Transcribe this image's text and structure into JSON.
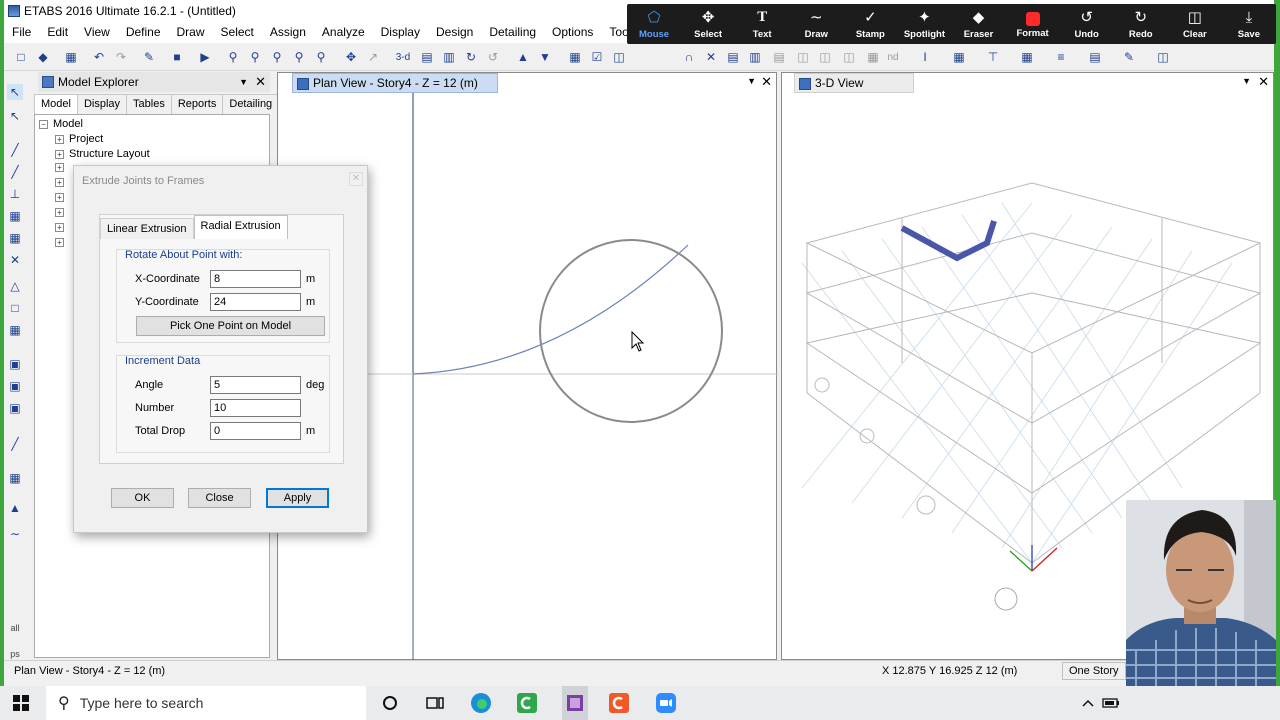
{
  "app": {
    "title": "ETABS 2016 Ultimate 16.2.1 - (Untitled)"
  },
  "menu": [
    "File",
    "Edit",
    "View",
    "Define",
    "Draw",
    "Select",
    "Assign",
    "Analyze",
    "Display",
    "Design",
    "Detailing",
    "Options",
    "Tools"
  ],
  "annotation_toolbar": [
    {
      "label": "Mouse",
      "icon": "cursor-icon",
      "active": true
    },
    {
      "label": "Select",
      "icon": "move-icon"
    },
    {
      "label": "Text",
      "icon": "text-icon"
    },
    {
      "label": "Draw",
      "icon": "draw-icon"
    },
    {
      "label": "Stamp",
      "icon": "stamp-icon"
    },
    {
      "label": "Spotlight",
      "icon": "spotlight-icon"
    },
    {
      "label": "Eraser",
      "icon": "eraser-icon"
    },
    {
      "label": "Format",
      "icon": "format-icon",
      "color": "#ff2a2a"
    },
    {
      "label": "Undo",
      "icon": "undo-icon"
    },
    {
      "label": "Redo",
      "icon": "redo-icon"
    },
    {
      "label": "Clear",
      "icon": "trash-icon"
    },
    {
      "label": "Save",
      "icon": "save-icon"
    }
  ],
  "explorer": {
    "title": "Model Explorer",
    "tabs": [
      "Model",
      "Display",
      "Tables",
      "Reports",
      "Detailing"
    ],
    "tree_root": "Model",
    "tree_items": [
      "Project",
      "Structure Layout"
    ]
  },
  "views": {
    "plan": {
      "title": "Plan View - Story4 - Z = 12 (m)"
    },
    "three_d": {
      "title": "3-D View"
    }
  },
  "dialog": {
    "title": "Extrude Joints to Frames",
    "tabs": [
      "Linear Extrusion",
      "Radial Extrusion"
    ],
    "active_tab": "Radial Extrusion",
    "rotate_group": "Rotate About Point with:",
    "x_label": "X-Coordinate",
    "x_value": "8",
    "x_unit": "m",
    "y_label": "Y-Coordinate",
    "y_value": "24",
    "y_unit": "m",
    "pick_button": "Pick One Point on Model",
    "increment_group": "Increment Data",
    "angle_label": "Angle",
    "angle_value": "5",
    "angle_unit": "deg",
    "number_label": "Number",
    "number_value": "10",
    "drop_label": "Total Drop",
    "drop_value": "0",
    "drop_unit": "m",
    "ok": "OK",
    "close": "Close",
    "apply": "Apply"
  },
  "status": {
    "left": "Plan View - Story4 - Z = 12 (m)",
    "coords": "X 12.875  Y 16.925  Z 12 (m)",
    "story": "One Story"
  },
  "sidebar_cutoff": [
    "all",
    "ps"
  ],
  "taskbar": {
    "search_placeholder": "Type here to search",
    "apps": [
      "cortana-icon",
      "task-view-icon",
      "edge-icon",
      "camtasia-icon",
      "etabs-icon",
      "recorder-icon",
      "zoom-icon"
    ]
  }
}
